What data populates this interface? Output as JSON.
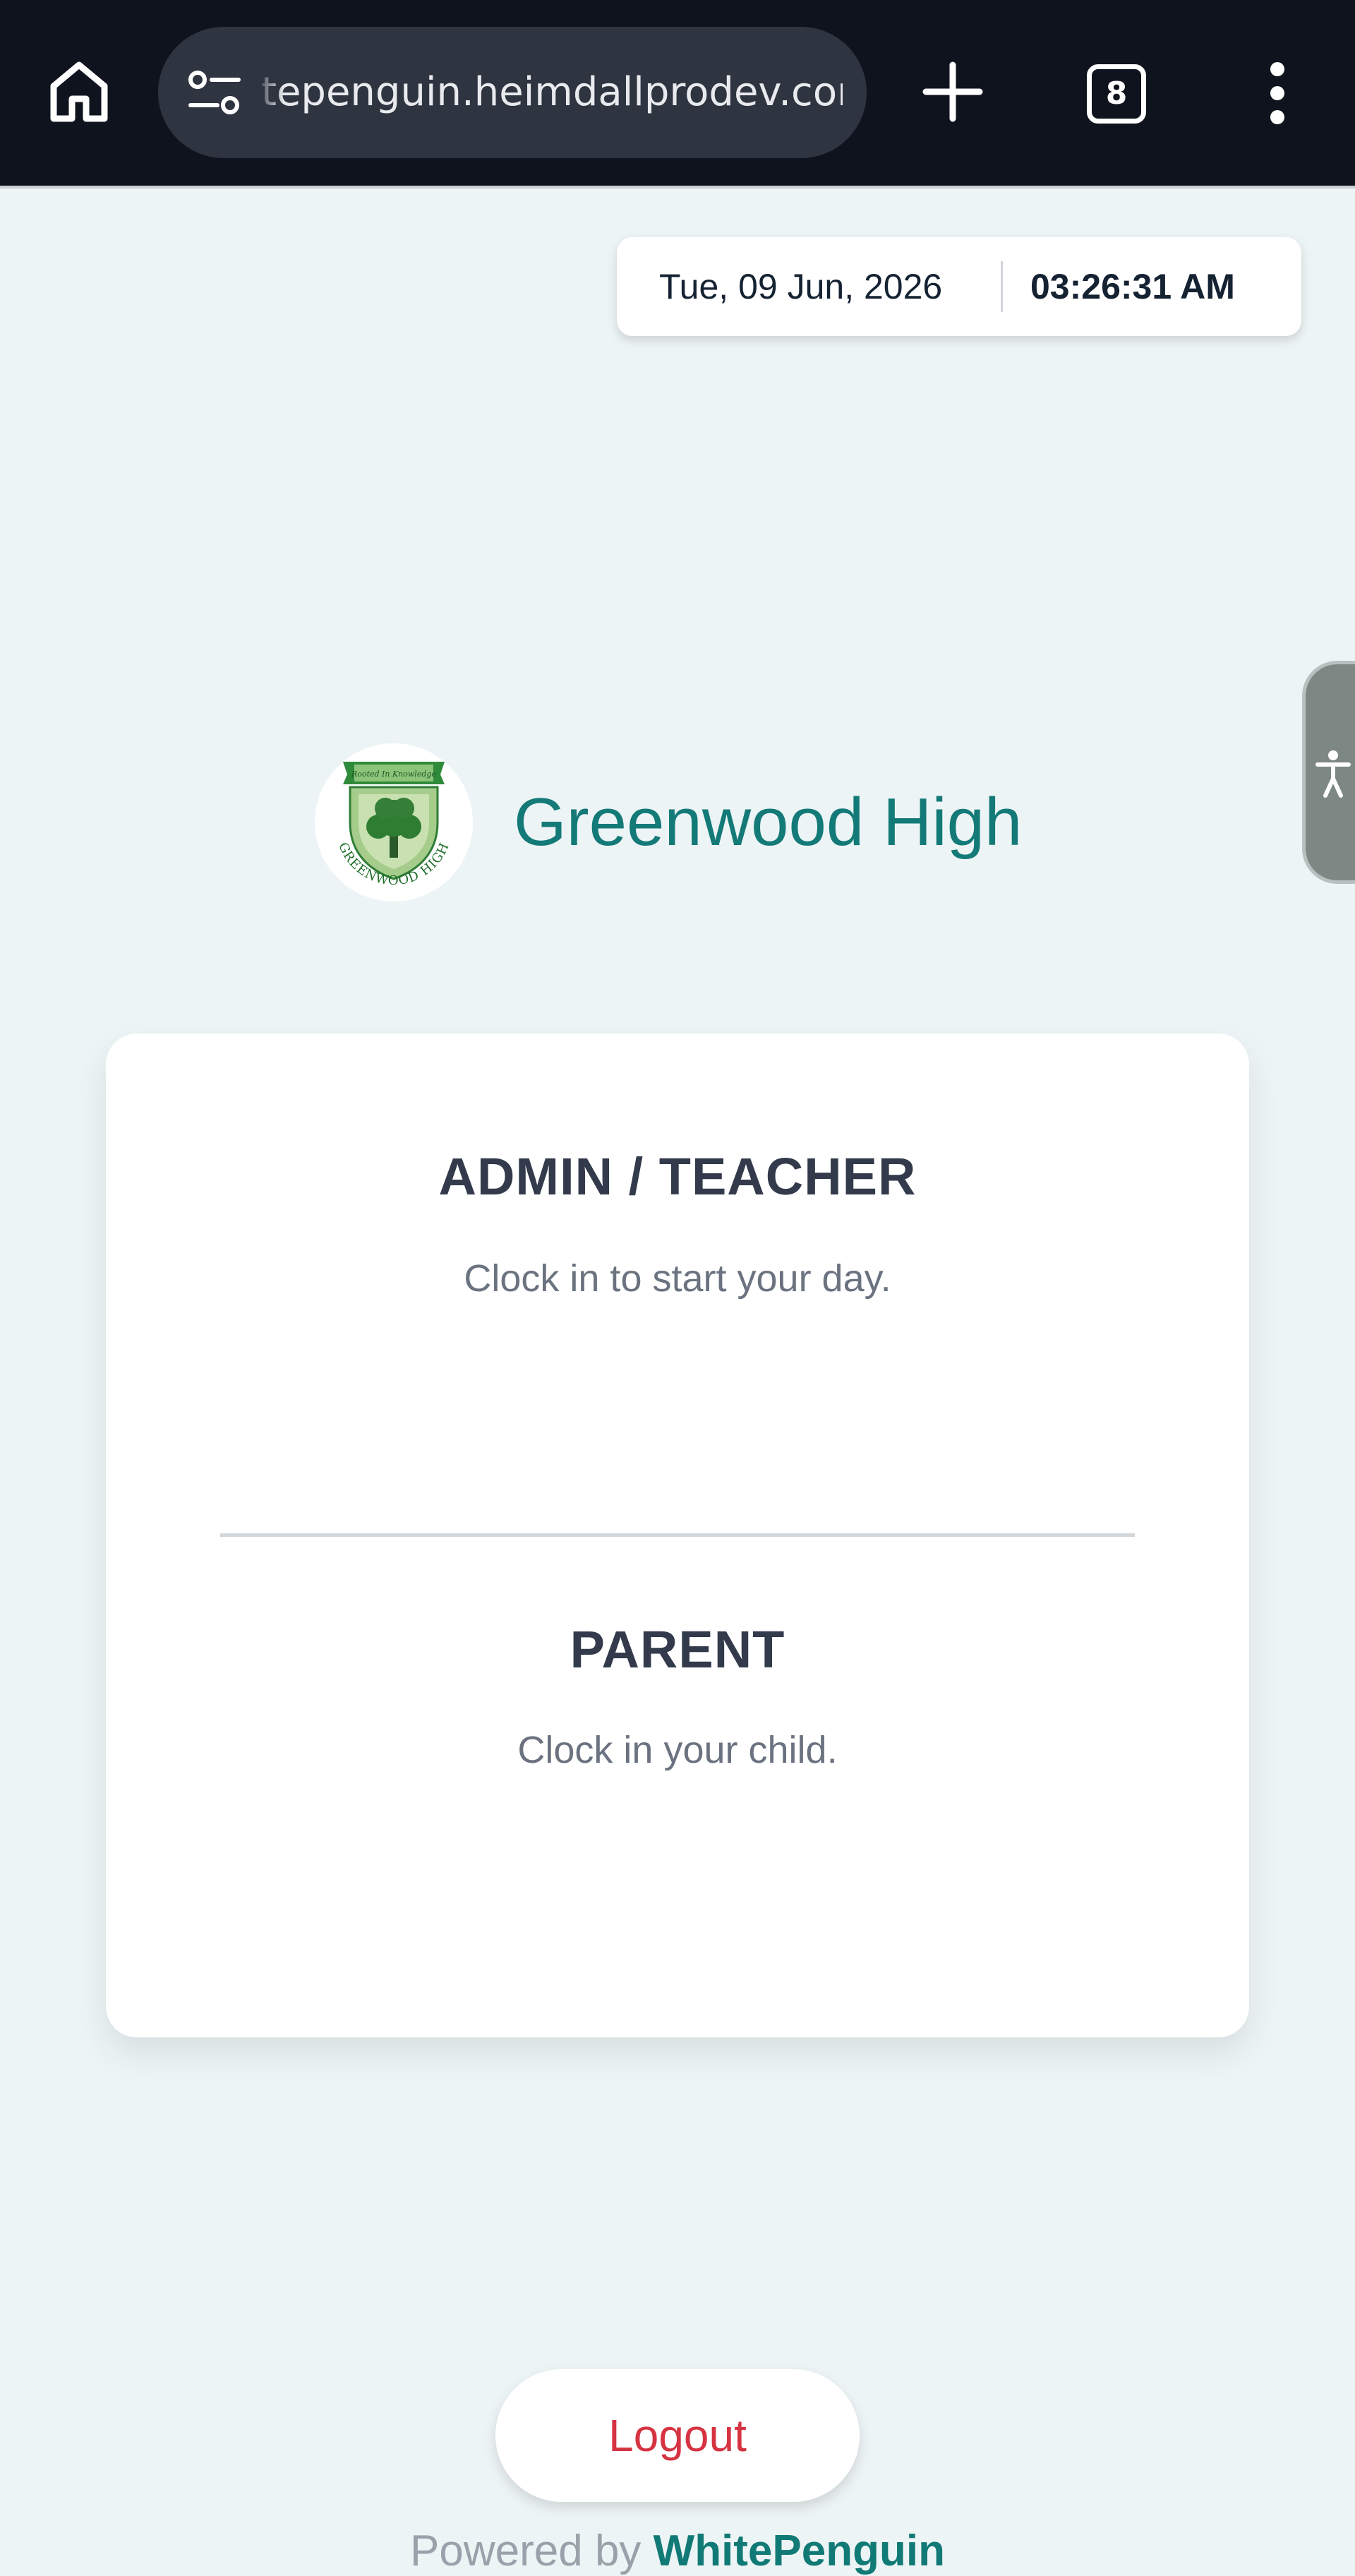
{
  "browser": {
    "url": "tepenguin.heimdallprodev.com",
    "tab_count": "8",
    "icons": [
      "home-icon",
      "site-settings-icon",
      "plus-icon",
      "tabs-icon",
      "more-vert-icon"
    ]
  },
  "datetime": {
    "date": "Tue, 09 Jun, 2026",
    "time": "03:26:31 AM"
  },
  "accessibility": {
    "icon": "accessibility-person-icon"
  },
  "school": {
    "name": "Greenwood High",
    "logo_text": "GREENWOOD HIGH",
    "logo_motto": "Rooted In Knowledge"
  },
  "roles": [
    {
      "title": "ADMIN / TEACHER",
      "subtitle": "Clock in to start your day."
    },
    {
      "title": "PARENT",
      "subtitle": "Clock in your child."
    }
  ],
  "logout_label": "Logout",
  "footer": {
    "powered_by": "Powered by",
    "brand": "WhitePenguin"
  },
  "colors": {
    "page_bg": "#edf4f5",
    "brand_teal": "#137a78",
    "logout_red": "#d63342",
    "browser_bar": "#0f131e"
  }
}
